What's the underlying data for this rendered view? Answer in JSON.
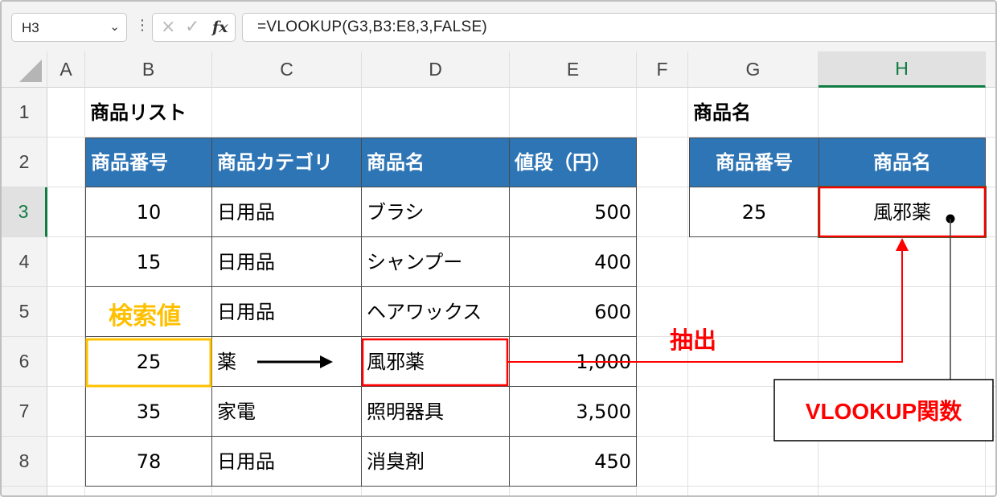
{
  "formula_bar": {
    "name_box": "H3",
    "more_icon": "vertical-ellipsis-icon",
    "cancel_icon": "×",
    "enter_icon": "✓",
    "fx_label": "fx",
    "formula": "=VLOOKUP(G3,B3:E8,3,FALSE)"
  },
  "columns": [
    "A",
    "B",
    "C",
    "D",
    "E",
    "F",
    "G",
    "H"
  ],
  "rows": [
    "1",
    "2",
    "3",
    "4",
    "5",
    "6",
    "7",
    "8"
  ],
  "selected_cell": "H3",
  "sheet": {
    "list_title": "商品リスト",
    "headers": [
      "商品番号",
      "商品カテゴリ",
      "商品名",
      "値段（円）"
    ],
    "table": [
      {
        "no": "10",
        "category": "日用品",
        "name": "ブラシ",
        "price": "500"
      },
      {
        "no": "15",
        "category": "日用品",
        "name": "シャンプー",
        "price": "400"
      },
      {
        "no": "",
        "category": "日用品",
        "name": "ヘアワックス",
        "price": "600"
      },
      {
        "no": "25",
        "category": "薬",
        "name": "風邪薬",
        "price": "1,000"
      },
      {
        "no": "35",
        "category": "家電",
        "name": "照明器具",
        "price": "3,500"
      },
      {
        "no": "78",
        "category": "日用品",
        "name": "消臭剤",
        "price": "450"
      }
    ],
    "lookup_title": "商品名",
    "lookup_headers": [
      "商品番号",
      "商品名"
    ],
    "lookup_values": [
      "25",
      "風邪薬"
    ]
  },
  "annotations": {
    "search_value_label": "検索値",
    "extract_label": "抽出",
    "function_label": "VLOOKUP関数",
    "colors": {
      "search": "#ffc000",
      "extract": "#ff0000",
      "table_header": "#2e75b6",
      "selected_header_text": "#107c41"
    }
  }
}
